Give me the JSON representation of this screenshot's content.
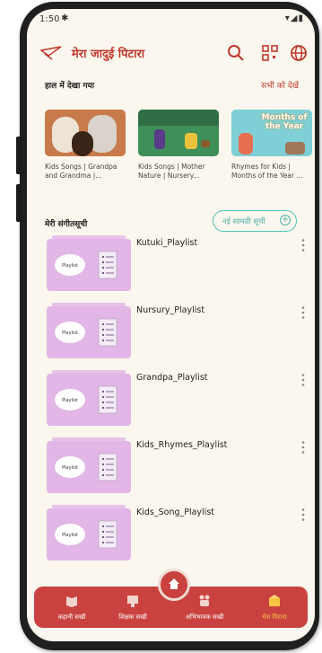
{
  "status": {
    "time": "1:50",
    "icons": "▾◢▮"
  },
  "app": {
    "title": "मेरा जादुई पिटारा"
  },
  "recent": {
    "heading": "हाल में देखा गया",
    "see_all": "सभी को देखें",
    "items": [
      {
        "caption": "Kids Songs | Grandpa and Grandma |..."
      },
      {
        "caption": "Kids Songs | Mother Nature | Nursery..."
      },
      {
        "caption": "Rhymes for Kids | Months of the Year ...",
        "thumb_text": "Months of the Year"
      }
    ]
  },
  "playlists": {
    "heading": "मेरी संगीतसूची",
    "new_button": "नई सामग्री सूची",
    "thumb_label": "Playlist",
    "items": [
      {
        "name": "Kutuki_Playlist"
      },
      {
        "name": "Nursury_Playlist"
      },
      {
        "name": "Grandpa_Playlist"
      },
      {
        "name": "Kids_Rhymes_Playlist"
      },
      {
        "name": "Kids_Song_Playlist"
      }
    ]
  },
  "nav": {
    "items": [
      {
        "label": "कहानी सखी"
      },
      {
        "label": "शिक्षक सखी"
      },
      {
        "label": "अभिभावक सखी"
      },
      {
        "label": "मेरा पिटारा"
      }
    ]
  },
  "colors": {
    "brand": "#c9423f",
    "accent": "#4fb3a8",
    "active_nav": "#f5c542"
  }
}
